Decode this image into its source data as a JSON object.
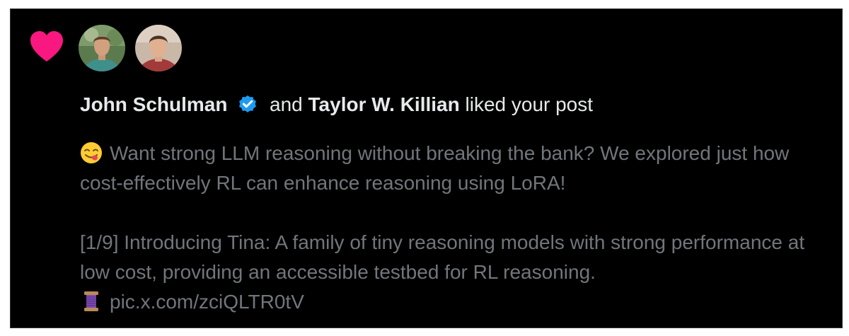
{
  "notification": {
    "icon": "heart-icon",
    "accent_color": "#f91880",
    "verified_color": "#1d9bf0",
    "users": [
      {
        "name": "John Schulman",
        "verified": true
      },
      {
        "name": "Taylor W. Killian",
        "verified": false
      }
    ],
    "connector": "and",
    "action_text": "liked your post"
  },
  "post": {
    "line1_emoji": "face-savoring-food-emoji",
    "paragraph1": "Want strong LLM reasoning without breaking the bank? We explored just how cost-effectively RL can enhance reasoning using LoRA!",
    "paragraph2": "[1/9] Introducing Tina: A family of tiny reasoning models with strong performance at low cost, providing an accessible testbed for RL reasoning.",
    "thread_emoji": "spool-of-thread-emoji",
    "link": "pic.x.com/zciQLTR0tV"
  }
}
